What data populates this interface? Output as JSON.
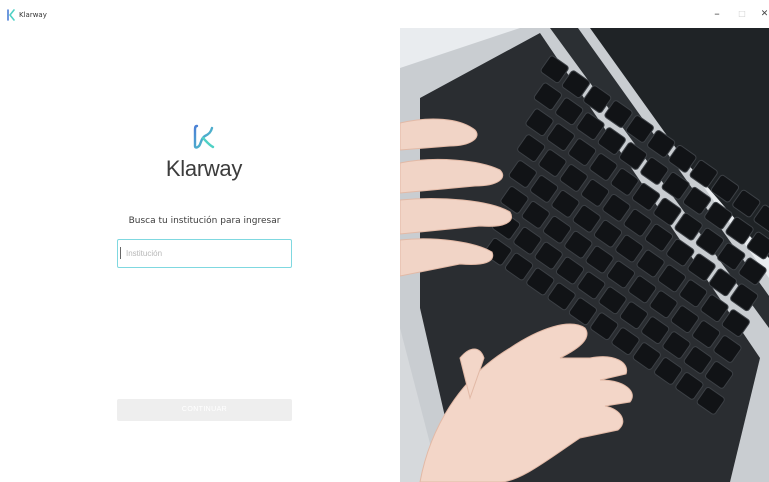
{
  "window": {
    "title": "Klarway",
    "minimize_icon": "minimize-icon",
    "maximize_icon": "maximize-icon",
    "close_icon": "close-icon"
  },
  "login": {
    "logo_text": "Klarway",
    "prompt": "Busca tu institución para ingresar",
    "institution_placeholder": "Institución",
    "institution_value": "",
    "continue_label": "CONTINUAR"
  },
  "colors": {
    "brand_teal": "#4fd1c5",
    "brand_blue": "#4b7fd6",
    "input_border": "#7fd8e0",
    "button_disabled": "#eeeeee"
  },
  "hero_image": {
    "icon": "laptop-typing-photo"
  }
}
